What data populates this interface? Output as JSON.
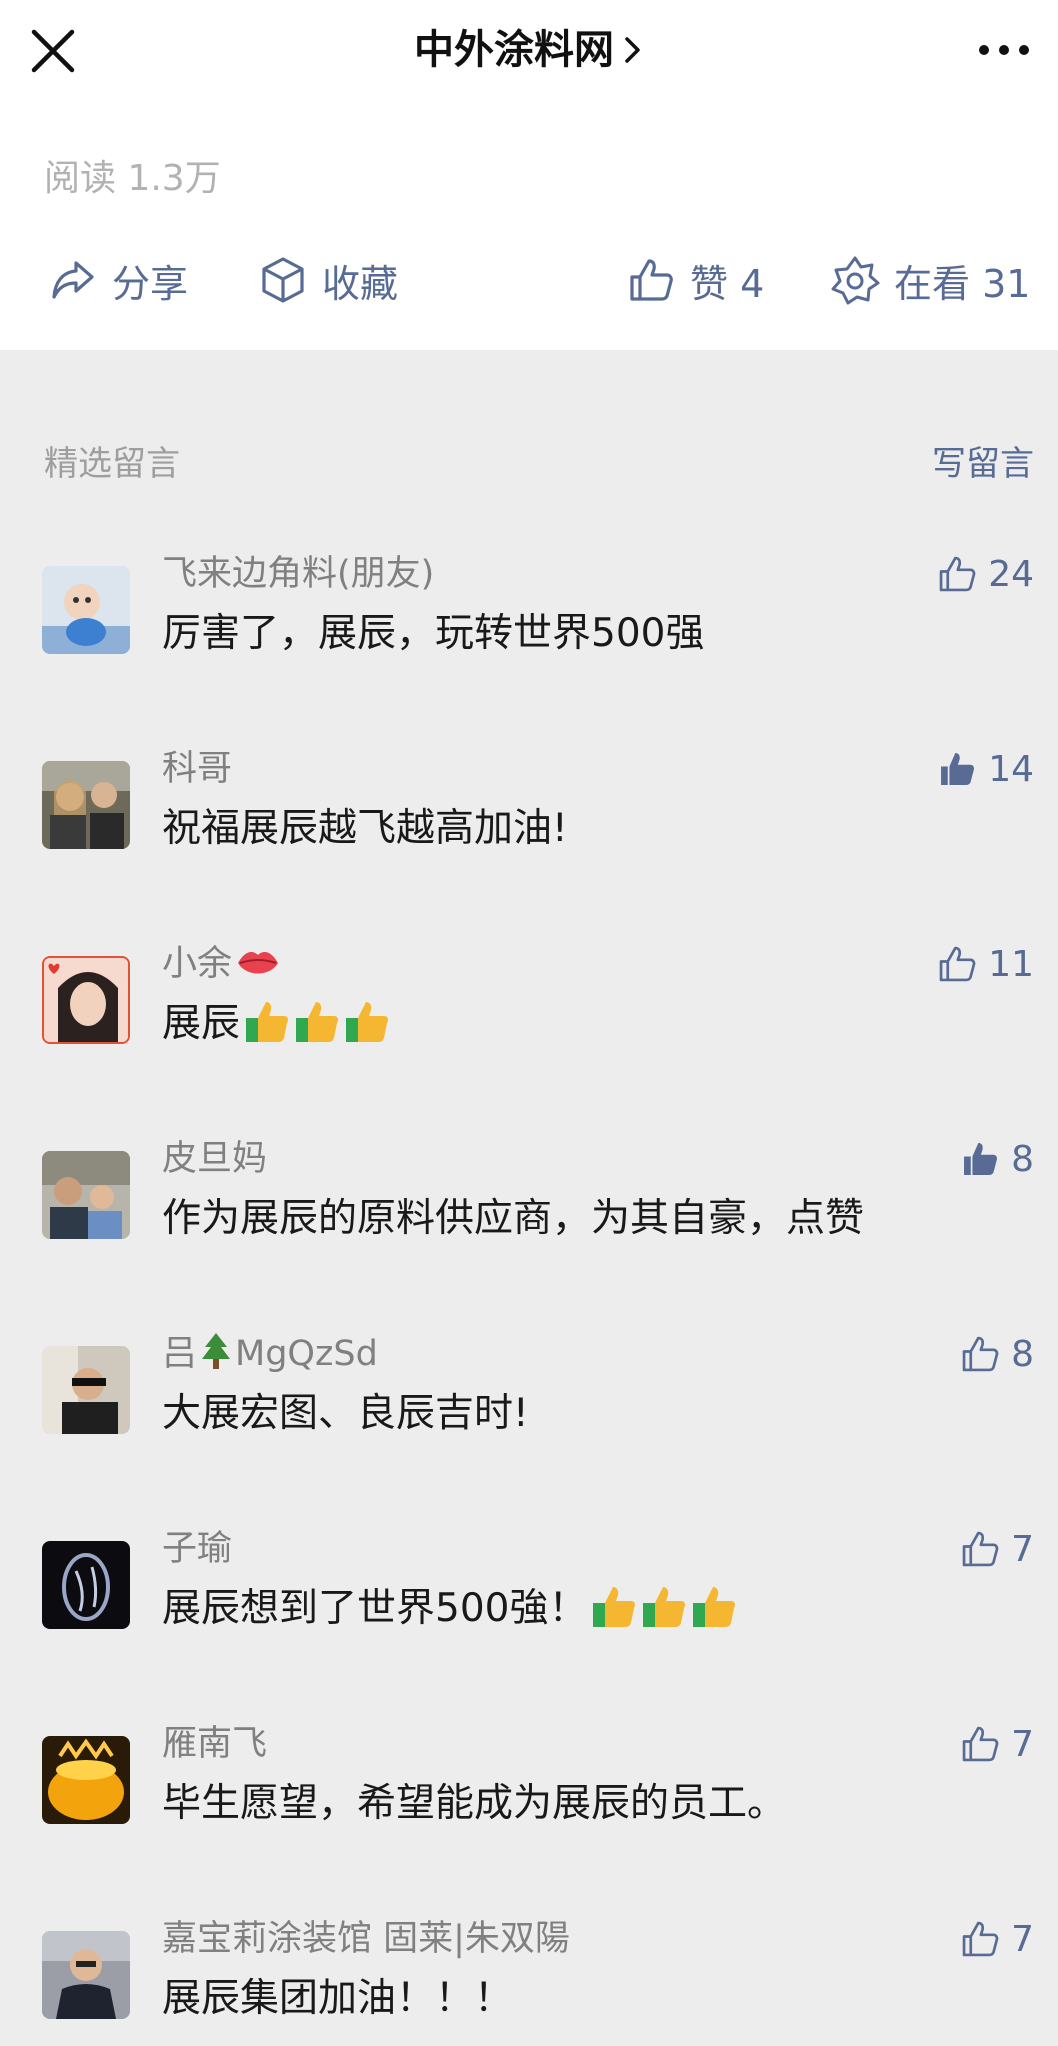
{
  "header": {
    "title": "中外涂料网"
  },
  "stats": {
    "reads": "阅读 1.3万"
  },
  "actions": {
    "share": "分享",
    "collect": "收藏",
    "like": "赞 4",
    "watching": "在看 31"
  },
  "comments_section": {
    "title": "精选留言",
    "write": "写留言",
    "items": [
      {
        "name": "飞来边角料(朋友)",
        "text": "厉害了，展辰，玩转世界500强",
        "likes": "24",
        "liked": false
      },
      {
        "name": "科哥",
        "text": "祝福展辰越飞越高加油!",
        "likes": "14",
        "liked": true
      },
      {
        "name": "小余",
        "text": "展辰",
        "likes": "11",
        "liked": false
      },
      {
        "name": "皮旦妈",
        "text": "作为展辰的原料供应商，为其自豪，点赞",
        "likes": "8",
        "liked": true
      },
      {
        "name_prefix": "吕",
        "name_suffix": "MgQzSd",
        "text": "大展宏图、良辰吉时!",
        "likes": "8",
        "liked": false
      },
      {
        "name": "子瑜",
        "text": "展辰想到了世界500強！",
        "likes": "7",
        "liked": false
      },
      {
        "name": "雁南飞",
        "text": "毕生愿望，希望能成为展辰的员工。",
        "likes": "7",
        "liked": false
      },
      {
        "name": "嘉宝莉涂装馆 固莱|朱双陽",
        "text": "展辰集团加油！！！",
        "likes": "7",
        "liked": false
      }
    ]
  },
  "colors": {
    "link": "#576b95",
    "background": "#ededed",
    "muted": "#b2b2b2"
  }
}
